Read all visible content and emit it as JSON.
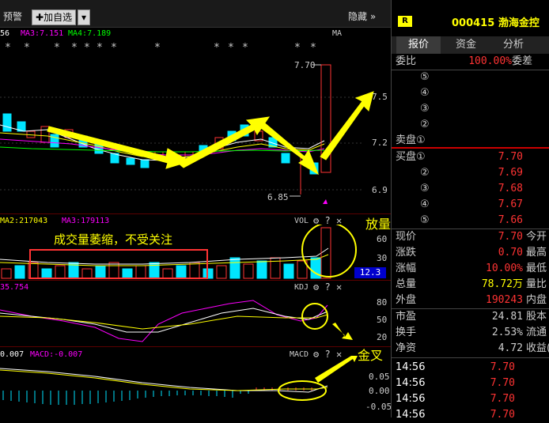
{
  "toolbar": {
    "alert_label": "预警",
    "add_watch_label": "加自选",
    "hide_label": "隐藏"
  },
  "main_chart": {
    "ma3_label": "MA3:7.151",
    "ma4_label": "MA4:7.189",
    "ma_left_partial": "56",
    "ma_right_label": "MA",
    "high_price_label": "7.70",
    "low_price_label": "6.85",
    "y_ticks": [
      "7.5",
      "7.2",
      "6.9"
    ]
  },
  "volume": {
    "ma2_label": "MA2:217043",
    "ma3_label": "MA3:179113",
    "title": "VOL",
    "y_ticks": [
      "60",
      "30"
    ],
    "current_badge": "12.3"
  },
  "kdj": {
    "left_value": "35.754",
    "title": "KDJ",
    "y_ticks": [
      "80",
      "50",
      "20"
    ]
  },
  "macd": {
    "left_value": "0.007",
    "macd_label": "MACD:-0.007",
    "title": "MACD",
    "y_ticks": [
      "0.05",
      "0.00",
      "-0.05"
    ]
  },
  "annotations": {
    "volume_shrink": "成交量萎缩，不受关注",
    "volume_up": "放量上涨",
    "golden_cross": "金叉"
  },
  "panel": {
    "badge": "R",
    "stock_code": "000415",
    "stock_name": "渤海金控",
    "tabs": [
      "报价",
      "资金",
      "分析"
    ],
    "weibi_label": "委比",
    "weibi_value": "100.00%",
    "weicha_label": "委差",
    "sell_levels": [
      "⑤",
      "④",
      "③",
      "②",
      "卖盘①"
    ],
    "buy_levels": [
      {
        "label": "买盘①",
        "price": "7.70"
      },
      {
        "label": "②",
        "price": "7.69"
      },
      {
        "label": "③",
        "price": "7.68"
      },
      {
        "label": "④",
        "price": "7.67"
      },
      {
        "label": "⑤",
        "price": "7.66"
      }
    ],
    "quote": [
      {
        "label": "现价",
        "value": "7.70",
        "right": "今开"
      },
      {
        "label": "涨跌",
        "value": "0.70",
        "right": "最高"
      },
      {
        "label": "涨幅",
        "value": "10.00%",
        "right": "最低"
      },
      {
        "label": "总量",
        "value": "78.72万",
        "right": "量比"
      },
      {
        "label": "外盘",
        "value": "190243",
        "right": "内盘"
      }
    ],
    "stats": [
      {
        "label": "市盈",
        "value": "24.81",
        "right": "股本"
      },
      {
        "label": "换手",
        "value": "2.53%",
        "right": "流通"
      },
      {
        "label": "净资",
        "value": "4.72",
        "right": "收益(三"
      }
    ],
    "ticks": [
      {
        "time": "14:56",
        "price": "7.70"
      },
      {
        "time": "14:56",
        "price": "7.70"
      },
      {
        "time": "14:56",
        "price": "7.70"
      },
      {
        "time": "14:56",
        "price": "7.70"
      }
    ]
  },
  "colors": {
    "up": "#ff3333",
    "down": "#00e5ff",
    "accent_yellow": "#ffff00",
    "ma_white": "#ffffff",
    "ma_yellow": "#ffff00",
    "ma_magenta": "#ff00ff",
    "ma_green": "#00ff00"
  }
}
